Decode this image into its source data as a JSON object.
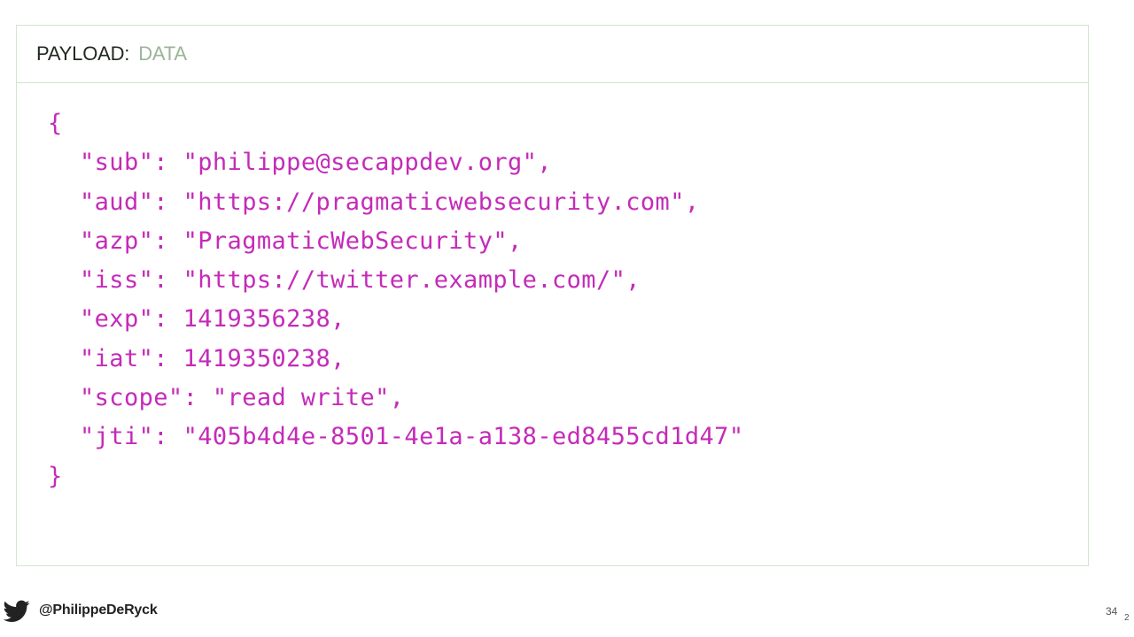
{
  "header": {
    "key": "PAYLOAD:",
    "value": "DATA"
  },
  "code": {
    "lines": [
      "{",
      "\"sub\": \"philippe@secappdev.org\",",
      "\"aud\": \"https://pragmaticwebsecurity.com\",",
      "\"azp\": \"PragmaticWebSecurity\",",
      "\"iss\": \"https://twitter.example.com/\",",
      "\"exp\": 1419356238,",
      "\"iat\": 1419350238,",
      "\"scope\": \"read write\",",
      "\"jti\": \"405b4d4e-8501-4e1a-a138-ed8455cd1d47\"",
      "}"
    ]
  },
  "footer": {
    "handle": "@PhilippeDeRyck",
    "page_number": "34",
    "page_number_sub": "2",
    "icon": "twitter-bird-icon"
  },
  "colors": {
    "code": "#c42bb8",
    "border": "#d3e5cf",
    "header_key": "#1f2a1f",
    "header_value": "#9ab596"
  }
}
